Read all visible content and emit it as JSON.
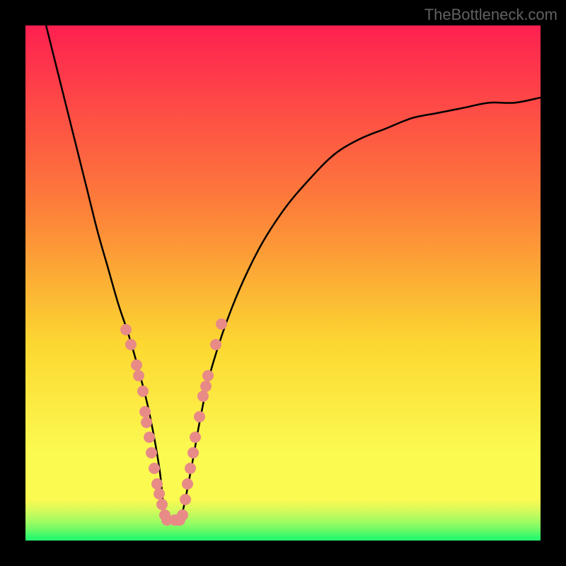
{
  "watermark": "TheBottleneck.com",
  "colors": {
    "bg_black": "#000000",
    "gradient_top": "#fe2050",
    "gradient_mid1": "#fd7e3a",
    "gradient_mid2": "#fcd831",
    "gradient_low": "#fbfa51",
    "green_bright": "#2cf96d",
    "curve": "#000000",
    "dot": "#e88b87",
    "watermark_color": "#616161"
  },
  "chart_data": {
    "type": "line",
    "title": "",
    "xlabel": "",
    "ylabel": "",
    "xlim": [
      0,
      100
    ],
    "ylim": [
      0,
      100
    ],
    "series": [
      {
        "name": "bottleneck-curve",
        "x": [
          4,
          6,
          8,
          10,
          12,
          14,
          16,
          18,
          20,
          22,
          24,
          26,
          27,
          28,
          30,
          32,
          34,
          36,
          40,
          45,
          50,
          55,
          60,
          65,
          70,
          75,
          80,
          85,
          90,
          95,
          100
        ],
        "y": [
          100,
          92,
          84,
          76,
          68,
          60,
          53,
          46,
          40,
          33,
          25,
          14,
          5,
          4,
          4,
          13,
          24,
          33,
          45,
          56,
          64,
          70,
          75,
          78,
          80,
          82,
          83,
          84,
          85,
          85,
          86
        ]
      }
    ],
    "dots": [
      {
        "x": 19.5,
        "y": 41
      },
      {
        "x": 20.5,
        "y": 38
      },
      {
        "x": 21.5,
        "y": 34
      },
      {
        "x": 22.0,
        "y": 32
      },
      {
        "x": 22.8,
        "y": 29
      },
      {
        "x": 23.2,
        "y": 25
      },
      {
        "x": 23.5,
        "y": 23
      },
      {
        "x": 24.0,
        "y": 20
      },
      {
        "x": 24.5,
        "y": 17
      },
      {
        "x": 25.0,
        "y": 14
      },
      {
        "x": 25.5,
        "y": 11
      },
      {
        "x": 26.0,
        "y": 9
      },
      {
        "x": 26.5,
        "y": 7
      },
      {
        "x": 27.0,
        "y": 5
      },
      {
        "x": 27.5,
        "y": 4
      },
      {
        "x": 29.0,
        "y": 4
      },
      {
        "x": 29.5,
        "y": 4
      },
      {
        "x": 30.0,
        "y": 4
      },
      {
        "x": 30.5,
        "y": 5
      },
      {
        "x": 31.0,
        "y": 8
      },
      {
        "x": 31.5,
        "y": 11
      },
      {
        "x": 32.0,
        "y": 14
      },
      {
        "x": 32.5,
        "y": 17
      },
      {
        "x": 33.0,
        "y": 20
      },
      {
        "x": 33.8,
        "y": 24
      },
      {
        "x": 34.5,
        "y": 28
      },
      {
        "x": 35.0,
        "y": 30
      },
      {
        "x": 35.5,
        "y": 32
      },
      {
        "x": 37.0,
        "y": 38
      },
      {
        "x": 38.0,
        "y": 42
      }
    ],
    "green_band_y": 8,
    "gradient_stops": [
      {
        "stop": 0,
        "color_key": "gradient_top"
      },
      {
        "stop": 35,
        "color_key": "gradient_mid1"
      },
      {
        "stop": 62,
        "color_key": "gradient_mid2"
      },
      {
        "stop": 83,
        "color_key": "gradient_low"
      },
      {
        "stop": 90,
        "color_key": "gradient_low"
      }
    ]
  }
}
